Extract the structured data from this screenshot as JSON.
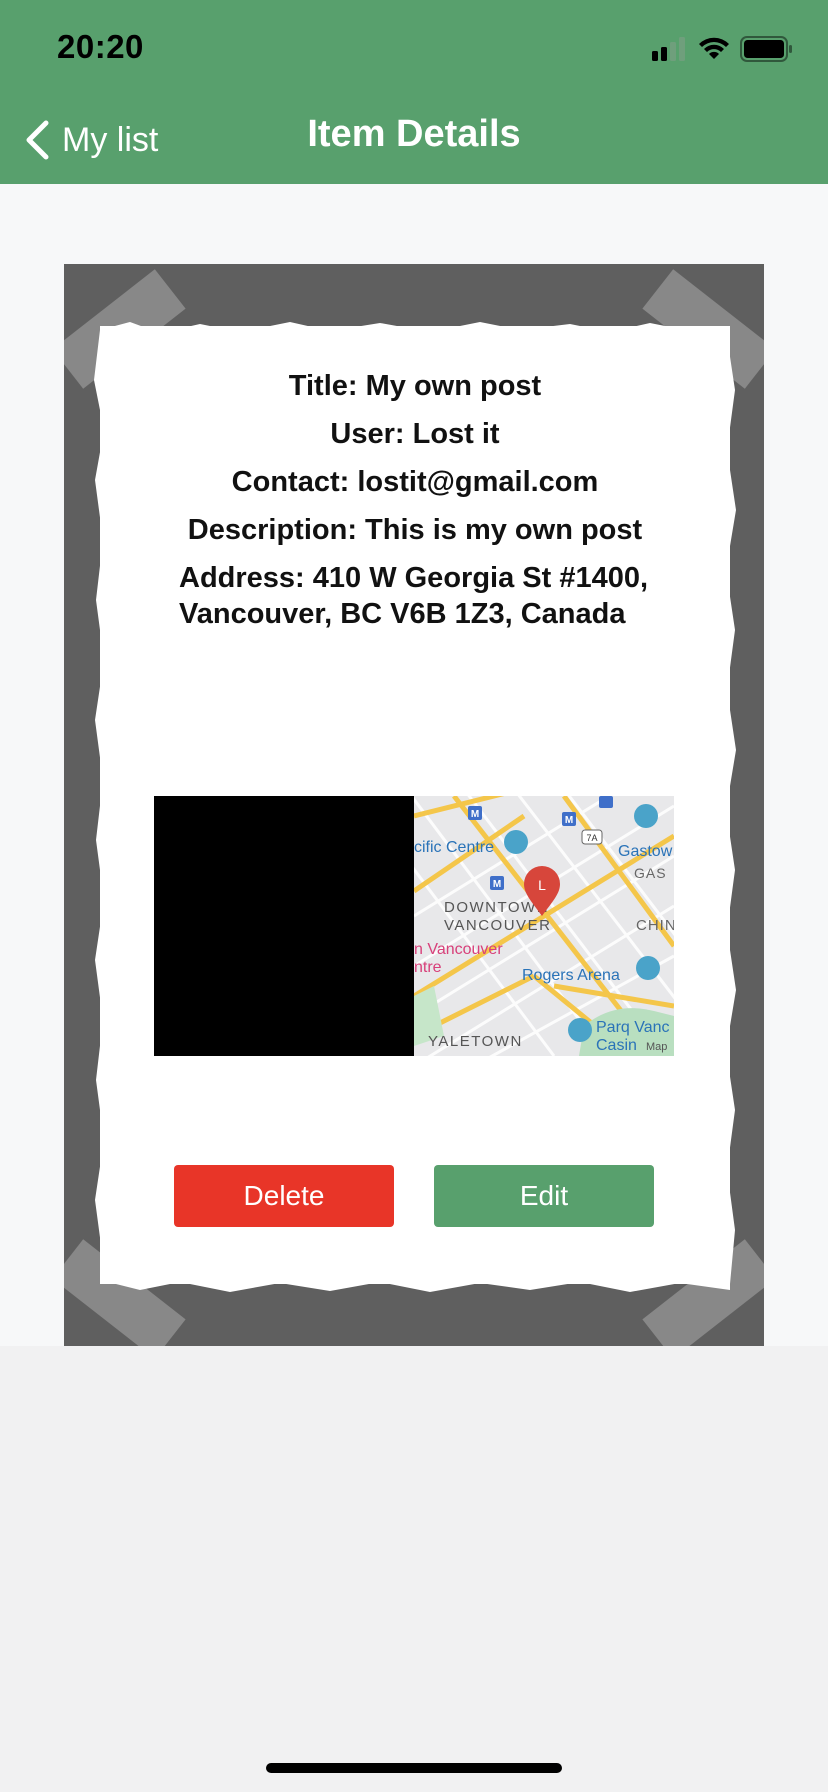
{
  "status_bar": {
    "time": "20:20"
  },
  "nav": {
    "back_label": "My list",
    "title": "Item Details"
  },
  "item": {
    "title_line": "Title:  My own post",
    "user_line": "User:  Lost it",
    "contact_line": "Contact:  lostit@gmail.com",
    "description_line": "Description:  This is my own post",
    "address_line": "Address:  410 W Georgia St #1400, Vancouver, BC V6B 1Z3, Canada"
  },
  "map": {
    "pin_label": "L",
    "labels": {
      "pacific_centre": "cific Centre",
      "gastown": "Gastow",
      "gas": "GAS",
      "downtown_1": "DOWNTOWN",
      "downtown_2": "VANCOUVER",
      "chin": "CHIN",
      "vancouver_centre_1": "n Vancouver",
      "vancouver_centre_2": "ntre",
      "rogers_arena": "Rogers Arena",
      "yaletown": "YALETOWN",
      "parq_1": "Parq Vanc",
      "parq_2": "Casin",
      "maps": "Map",
      "highway": "7A",
      "metro": "M"
    }
  },
  "actions": {
    "delete_label": "Delete",
    "edit_label": "Edit"
  },
  "icons": {
    "back": "chevron-left-icon",
    "signal": "signal-icon",
    "wifi": "wifi-icon",
    "battery": "battery-icon",
    "map_pin": "map-pin-icon"
  },
  "colors": {
    "header": "#58a06d",
    "delete": "#e83528",
    "edit": "#58a06d",
    "board": "#5f5f5f"
  }
}
